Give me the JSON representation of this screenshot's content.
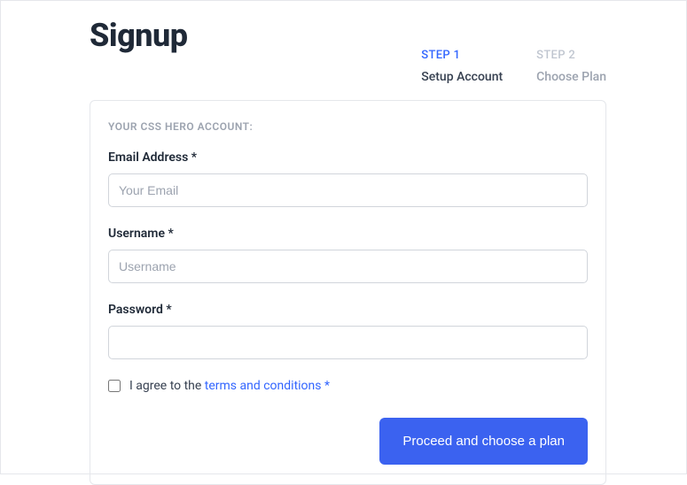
{
  "page": {
    "title": "Signup"
  },
  "steps": {
    "step1": {
      "label": "STEP 1",
      "desc": "Setup Account"
    },
    "step2": {
      "label": "STEP 2",
      "desc": "Choose Plan"
    }
  },
  "form": {
    "section_label": "YOUR CSS HERO ACCOUNT:",
    "email": {
      "label": "Email Address *",
      "placeholder": "Your Email",
      "value": ""
    },
    "username": {
      "label": "Username *",
      "placeholder": "Username",
      "value": ""
    },
    "password": {
      "label": "Password *",
      "placeholder": "",
      "value": ""
    },
    "agree": {
      "prefix": "I agree to the ",
      "link_text": "terms and conditions",
      "required_mark": " *"
    },
    "submit_label": "Proceed and choose a plan"
  }
}
